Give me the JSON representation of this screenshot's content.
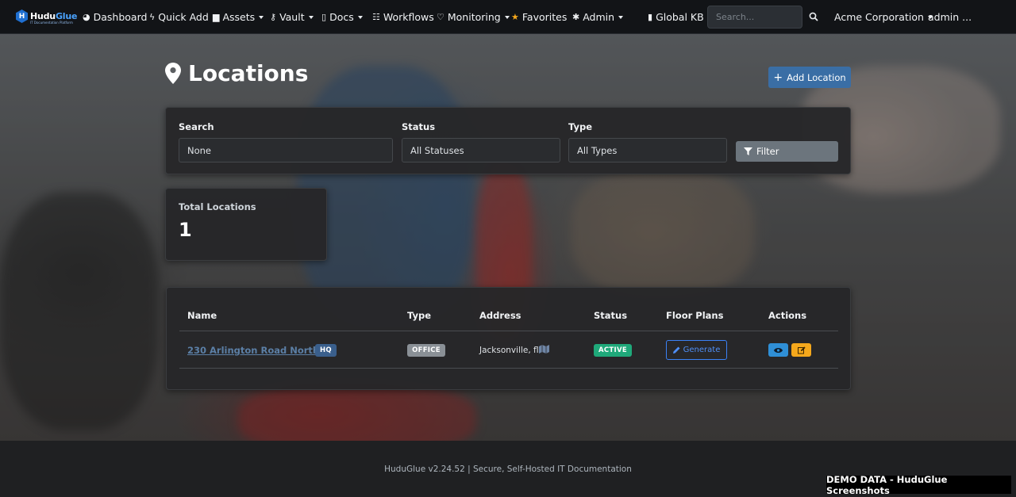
{
  "brand": {
    "name_part1": "Hudu",
    "name_part2": "Glue",
    "tagline": "IT Documentation Platform",
    "mark_letter": "H"
  },
  "nav": {
    "items": [
      {
        "label": "Dashboard",
        "icon": "dashboard-icon",
        "dropdown": false
      },
      {
        "label": "Quick Add",
        "icon": "bolt-icon",
        "dropdown": false
      },
      {
        "label": "Assets",
        "icon": "briefcase-icon",
        "dropdown": true
      },
      {
        "label": "Vault",
        "icon": "key-icon",
        "dropdown": true
      },
      {
        "label": "Docs",
        "icon": "file-icon",
        "dropdown": true
      },
      {
        "label": "Workflows",
        "icon": "tasks-icon",
        "dropdown": false
      },
      {
        "label": "Monitoring",
        "icon": "heartbeat-icon",
        "dropdown": true
      },
      {
        "label": "Favorites",
        "icon": "star-icon",
        "dropdown": false
      },
      {
        "label": "Admin",
        "icon": "gear-icon",
        "dropdown": true
      }
    ],
    "global_kb": "Global KB",
    "search_placeholder": "Search...",
    "company": "Acme Corporation",
    "user": "admin ..."
  },
  "page": {
    "title": "Locations",
    "add_button": "Add Location"
  },
  "filters": {
    "search_label": "Search",
    "search_value": "None",
    "status_label": "Status",
    "status_value": "All Statuses",
    "type_label": "Type",
    "type_value": "All Types",
    "filter_button": "Filter"
  },
  "stats": {
    "total_label": "Total Locations",
    "total_value": "1"
  },
  "table": {
    "headers": [
      "Name",
      "Type",
      "Address",
      "Status",
      "Floor Plans",
      "Actions"
    ],
    "rows": [
      {
        "name": "230 Arlington Road North",
        "name_badge": "HQ",
        "type": "OFFICE",
        "address": "Jacksonville, fl",
        "status": "ACTIVE",
        "floor_plans_button": "Generate"
      }
    ]
  },
  "colors": {
    "navbar_bg": "#121417",
    "primary": "#3a6ea5",
    "status_active": "#1fa97a",
    "badge_hq": "#3a5f8c",
    "badge_type": "#8a9096",
    "view_button": "#2f8fd6",
    "edit_button": "#f5a81c"
  },
  "footer": {
    "text": "HuduGlue v2.24.52 | Secure, Self-Hosted IT Documentation",
    "demo_tag": "DEMO DATA - HuduGlue Screenshots"
  }
}
